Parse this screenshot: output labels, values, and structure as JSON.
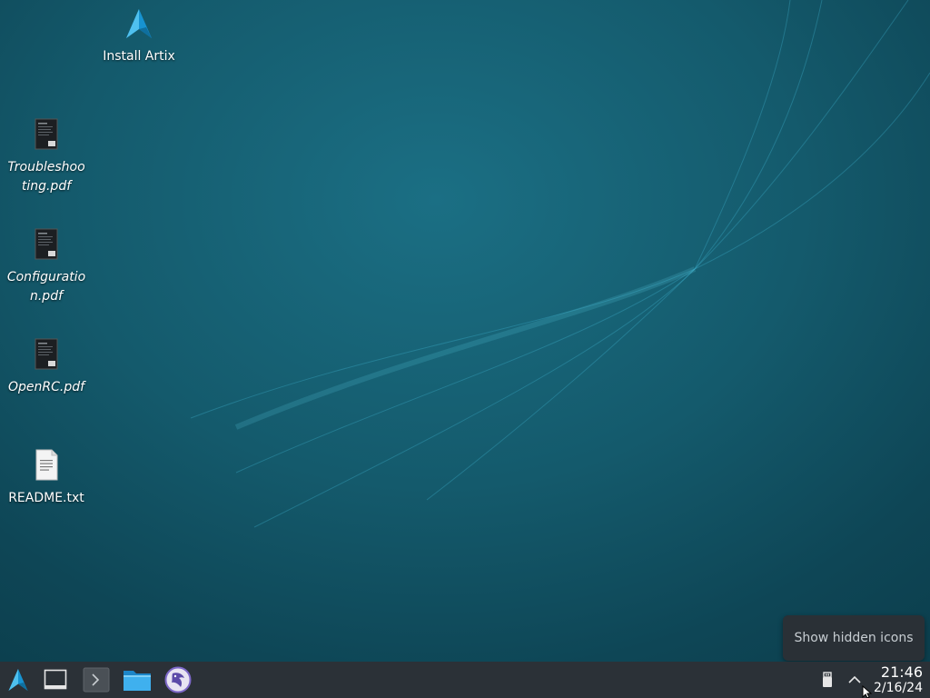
{
  "desktop": {
    "icons": [
      {
        "label": "Install Artix",
        "icon": "artix-logo-icon"
      },
      {
        "label": "Troubleshoo ting.pdf",
        "icon": "pdf-document-icon"
      },
      {
        "label": "Configuratio n.pdf",
        "icon": "pdf-document-icon"
      },
      {
        "label": "OpenRC.pdf",
        "icon": "pdf-document-icon"
      },
      {
        "label": "README.txt",
        "icon": "text-document-icon"
      }
    ]
  },
  "tooltip": {
    "text": "Show hidden icons"
  },
  "taskbar": {
    "launchers": [
      {
        "name": "application-menu",
        "icon": "artix-logo-icon"
      },
      {
        "name": "show-desktop",
        "icon": "show-desktop-icon"
      },
      {
        "name": "terminal",
        "icon": "terminal-icon"
      },
      {
        "name": "file-manager",
        "icon": "folder-icon"
      },
      {
        "name": "web-browser",
        "icon": "browser-icon"
      }
    ],
    "tray": {
      "usb_icon": "usb-drive-icon",
      "expand_icon": "chevron-up-icon"
    },
    "clock": {
      "time": "21:46",
      "date": "2/16/24"
    }
  },
  "colors": {
    "accent": "#1aa3d4",
    "taskbar": "#2b3137",
    "desktop": "#145a6c"
  }
}
